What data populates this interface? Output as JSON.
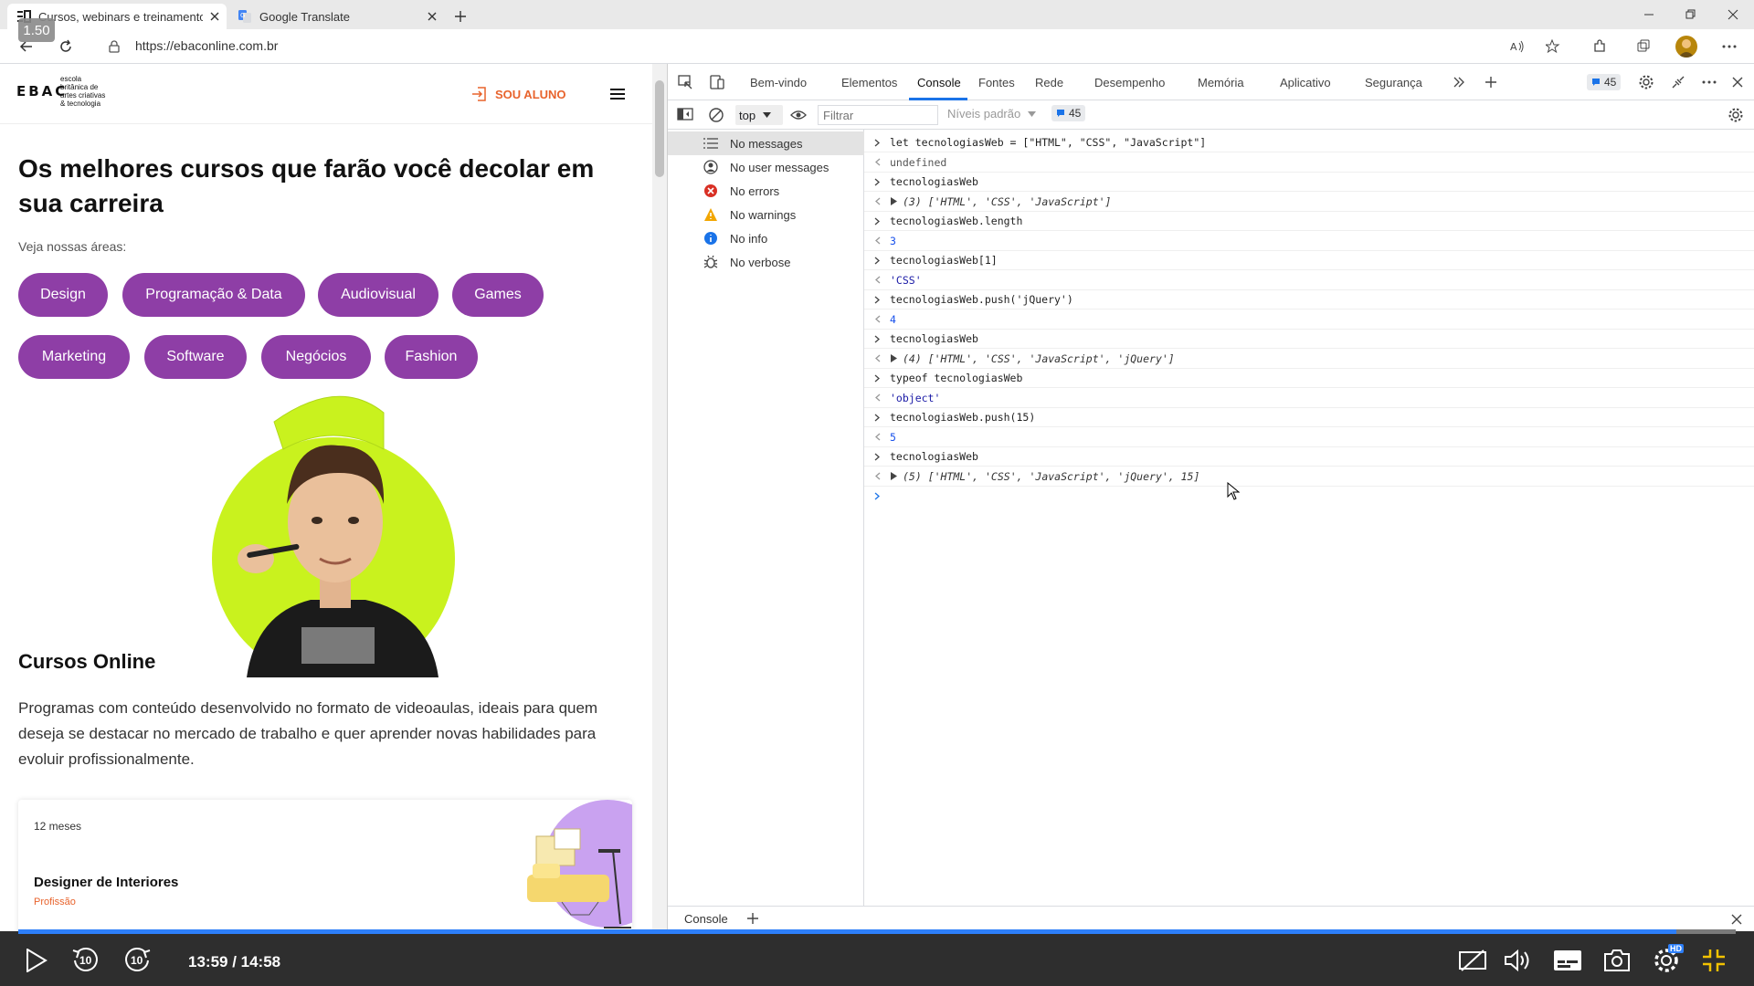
{
  "browser": {
    "speed": "1.50",
    "tabs": [
      {
        "title": "Cursos, webinars e treinamento"
      },
      {
        "title": "Google Translate"
      }
    ],
    "url": "https://ebaconline.com.br"
  },
  "site": {
    "logo_mark": "EBAC",
    "logo_lines": [
      "escola",
      "britânica de",
      "artes criativas",
      "& tecnologia"
    ],
    "sou_aluno": "SOU ALUNO",
    "headline": "Os melhores cursos que farão você decolar em sua carreira",
    "areas_label": "Veja nossas áreas:",
    "areas": [
      "Design",
      "Programação & Data",
      "Audiovisual",
      "Games",
      "Marketing",
      "Software",
      "Negócios",
      "Fashion"
    ],
    "courses_title": "Cursos Online",
    "courses_desc": "Programas com conteúdo desenvolvido no formato de videoaulas, ideais para quem deseja se destacar no mercado de trabalho e quer aprender novas habilidades para evoluir profissionalmente.",
    "card": {
      "duration": "12 meses",
      "name": "Designer de Interiores",
      "kind": "Profissão"
    }
  },
  "devtools": {
    "tabs": [
      "Bem-vindo",
      "Elementos",
      "Console",
      "Fontes",
      "Rede",
      "Desempenho",
      "Memória",
      "Aplicativo",
      "Segurança"
    ],
    "active_tab": "Console",
    "issues_count": "45",
    "context": "top",
    "filter_placeholder": "Filtrar",
    "levels": "Níveis padrão",
    "sidebar": [
      "No messages",
      "No user messages",
      "No errors",
      "No warnings",
      "No info",
      "No verbose"
    ],
    "drawer_tab": "Console"
  },
  "console_lines": [
    {
      "kind": "in",
      "text": "let tecnologiasWeb = [\"HTML\", \"CSS\", \"JavaScript\"]"
    },
    {
      "kind": "out",
      "text": "undefined"
    },
    {
      "kind": "in",
      "text": "tecnologiasWeb"
    },
    {
      "kind": "out-obj",
      "text": "(3) ['HTML', 'CSS', 'JavaScript']"
    },
    {
      "kind": "in",
      "text": "tecnologiasWeb.length"
    },
    {
      "kind": "out-num",
      "text": "3"
    },
    {
      "kind": "in",
      "text": "tecnologiasWeb[1]"
    },
    {
      "kind": "out-str",
      "text": "'CSS'"
    },
    {
      "kind": "in",
      "text": "tecnologiasWeb.push('jQuery')"
    },
    {
      "kind": "out-num",
      "text": "4"
    },
    {
      "kind": "in",
      "text": "tecnologiasWeb"
    },
    {
      "kind": "out-obj",
      "text": "(4) ['HTML', 'CSS', 'JavaScript', 'jQuery']"
    },
    {
      "kind": "in",
      "text": "typeof tecnologiasWeb"
    },
    {
      "kind": "out-str",
      "text": "'object'"
    },
    {
      "kind": "in",
      "text": "tecnologiasWeb.push(15)"
    },
    {
      "kind": "out-num",
      "text": "5"
    },
    {
      "kind": "in",
      "text": "tecnologiasWeb"
    },
    {
      "kind": "out-obj",
      "text": "(5) ['HTML', 'CSS', 'JavaScript', 'jQuery', 15]"
    }
  ],
  "player": {
    "time": "13:59 / 14:58",
    "progress": 0.9655,
    "skip_back": "10",
    "skip_forward": "10",
    "hd_badge": "HD"
  },
  "colors": {
    "brand_purple": "#8e3ea6",
    "accent_orange": "#e8632c",
    "devtools_blue": "#1a73e8",
    "hero_lime": "#c9f21e"
  }
}
